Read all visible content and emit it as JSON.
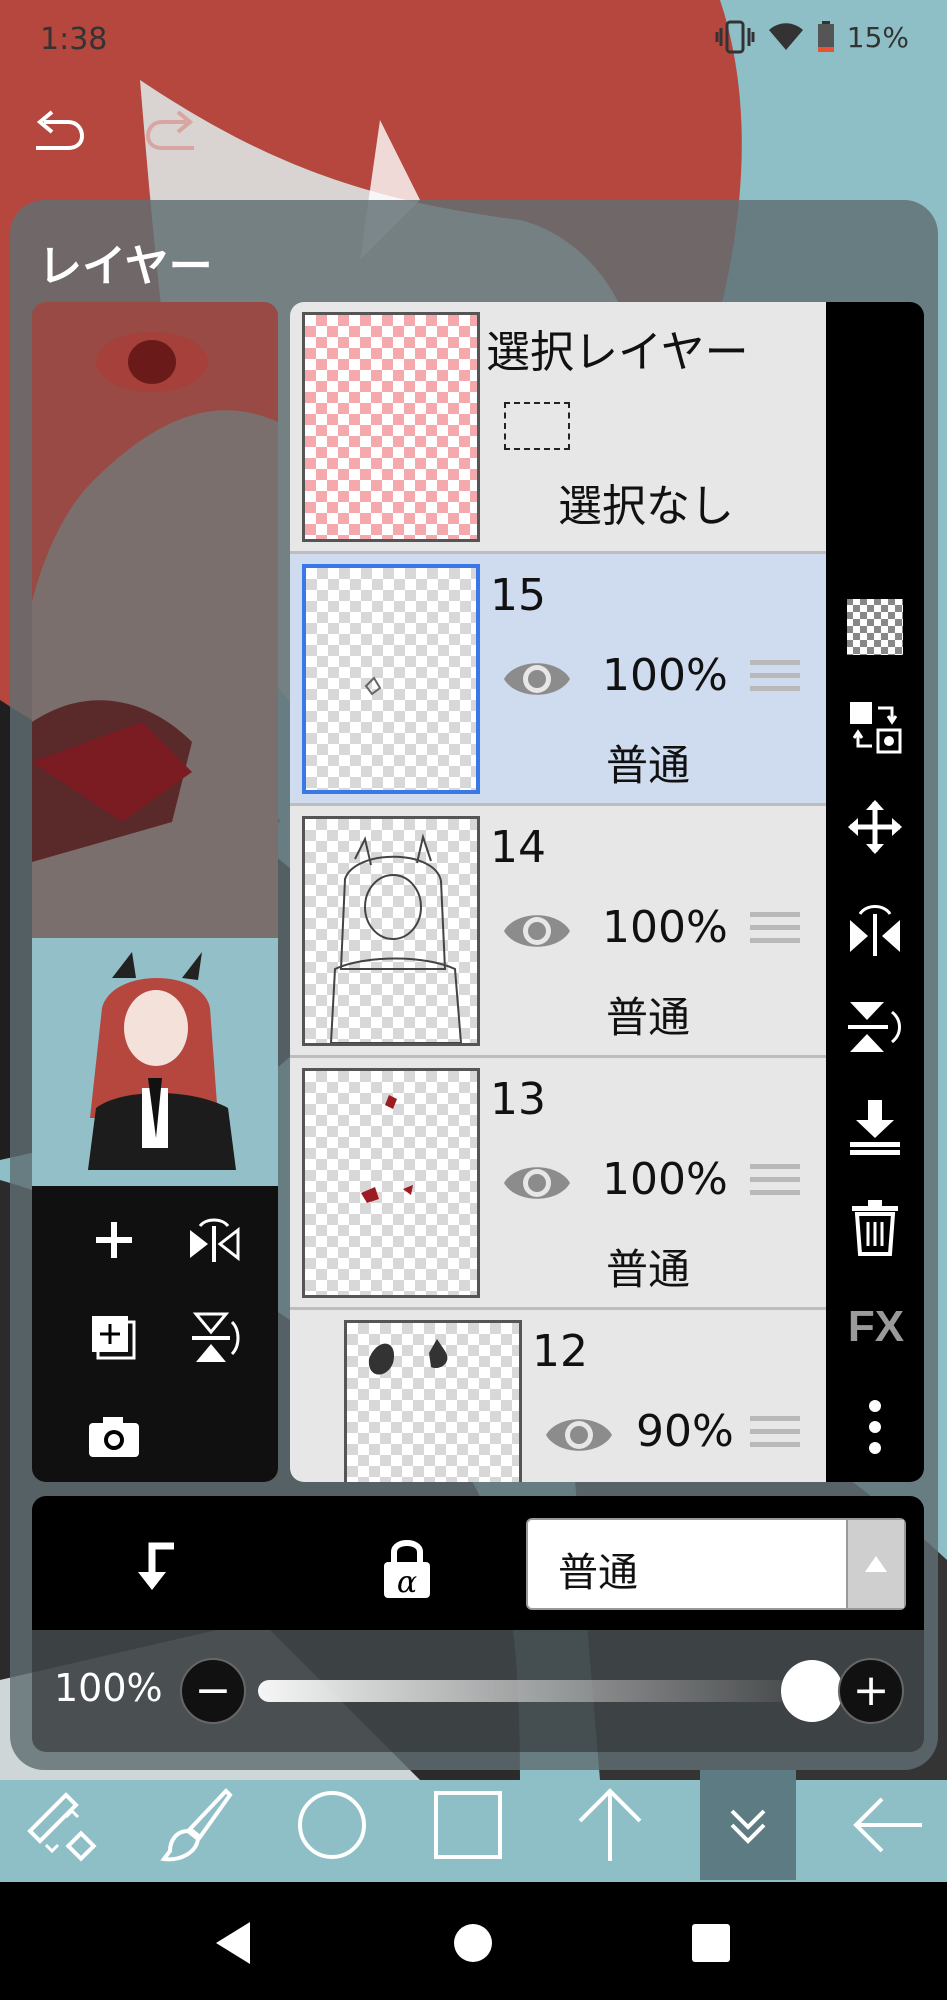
{
  "status_bar": {
    "time": "1:38",
    "battery_text": "15%",
    "icons": [
      "vibrate-icon",
      "wifi-icon",
      "battery-icon"
    ]
  },
  "toolbar_top": {
    "undo_icon": "undo-icon",
    "redo_icon": "redo-icon"
  },
  "panel": {
    "title": "レイヤー",
    "selection_layer": {
      "title": "選択レイヤー",
      "state": "選択なし"
    },
    "layers": [
      {
        "number": "15",
        "opacity": "100%",
        "blend": "普通",
        "visible": true,
        "selected": true
      },
      {
        "number": "14",
        "opacity": "100%",
        "blend": "普通",
        "visible": true,
        "selected": false
      },
      {
        "number": "13",
        "opacity": "100%",
        "blend": "普通",
        "visible": true,
        "selected": false
      },
      {
        "number": "12",
        "opacity": "90%",
        "blend": "",
        "visible": true,
        "selected": false
      }
    ],
    "preview_tools": [
      "add-layer-icon",
      "flip-horizontal-icon",
      "duplicate-layer-icon",
      "flip-vertical-icon",
      "camera-icon"
    ],
    "right_tools": {
      "items": [
        "transparency-icon",
        "swap-layer-icon",
        "move-icon",
        "flip-h-rotate-icon",
        "flip-v-rotate-icon",
        "merge-down-icon",
        "delete-icon",
        "fx-icon",
        "more-icon"
      ],
      "fx_label": "FX"
    },
    "blend_bar": {
      "clip_icon": "clip-icon",
      "alpha_lock_icon": "alpha-lock-icon",
      "blend_mode": "普通"
    },
    "opacity": {
      "label": "100%",
      "value": 1.0,
      "minus": "−",
      "plus": "+"
    }
  },
  "main_toolbar": {
    "items": [
      "select-transform-icon",
      "brush-icon",
      "circle-icon",
      "square-icon",
      "arrow-up-icon",
      "layer-down-icon",
      "back-arrow-icon"
    ],
    "active": "layer-down-icon"
  },
  "nav": {
    "items": [
      "back-nav-icon",
      "home-nav-icon",
      "recents-nav-icon"
    ]
  },
  "colors": {
    "canvas_bg": "#8fbfc6",
    "hair": "#b5473f",
    "selected_row": "#cfdbee",
    "selected_border": "#3b78e7"
  }
}
